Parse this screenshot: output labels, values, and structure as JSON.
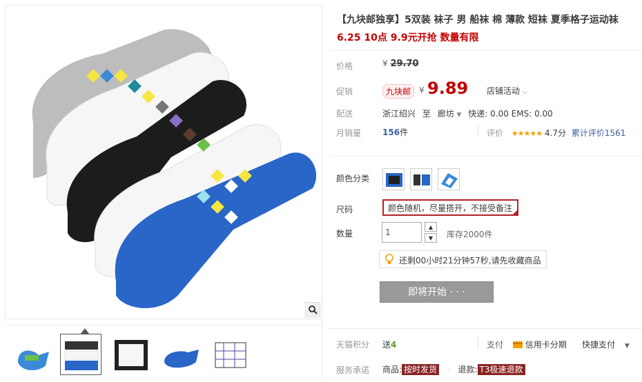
{
  "product": {
    "title": "【九块邮独享】5双装 袜子 男 船袜 棉 薄款 短袜 夏季格子运动袜",
    "subtitle": "6.25 10点 9.9元开抢 数量有限"
  },
  "price": {
    "label": "价格",
    "currency": "¥",
    "original": "29.70"
  },
  "promo": {
    "label": "促销",
    "tag": "九块邮",
    "currency": "¥",
    "price": "9.89",
    "store_activity": "店铺活动"
  },
  "shipping": {
    "label": "配送",
    "from": "浙江绍兴",
    "to_word": "至",
    "destination": "廊坊",
    "fees": "快递: 0.00 EMS: 0.00"
  },
  "sales": {
    "label": "月销量",
    "count": "156",
    "unit": "件",
    "rating_label": "评价",
    "stars": "★★★★★",
    "score": "4.7分",
    "cumulative": "累计评价1561"
  },
  "sku": {
    "color_label": "颜色分类",
    "size_label": "尺码",
    "size_note": "颜色随机，尽量搭开，不接受备注",
    "quantity_label": "数量",
    "quantity_value": "1",
    "stock": "库存2000件"
  },
  "notice": {
    "text": "还剩00小时21分钟57秒,请先收藏商品"
  },
  "buy": {
    "start_label": "即将开始 · · ·"
  },
  "points": {
    "label": "天猫积分",
    "give_word": "送",
    "value": "4"
  },
  "payment": {
    "label": "支付",
    "credit": "信用卡分期",
    "quick": "快捷支付"
  },
  "service": {
    "label": "服务承诺",
    "goods_word": "商品:",
    "goods_badge": "按时发货",
    "refund_word": "退款:",
    "refund_badge": "T3极速退款"
  },
  "colors": {
    "accent": "#c40000",
    "link": "#3a5f9f",
    "star": "#f0a000",
    "button": "#999999"
  }
}
